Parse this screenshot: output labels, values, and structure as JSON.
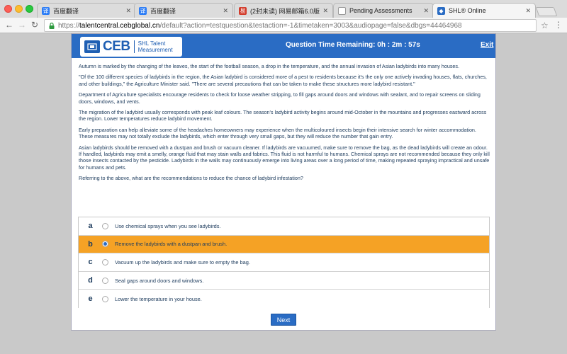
{
  "browser": {
    "tabs": [
      {
        "label": "百度翻译",
        "icon": "baidu-translate-icon",
        "icon_color": "#2b7cf6",
        "active": false
      },
      {
        "label": "百度翻译",
        "icon": "baidu-translate-icon",
        "icon_color": "#2b7cf6",
        "active": false
      },
      {
        "label": "(2封未读) 网易邮箱6.0版",
        "icon": "netease-mail-icon",
        "icon_color": "#d23b2b",
        "active": false
      },
      {
        "label": "Pending Assessments",
        "icon": "document-icon",
        "icon_color": "#ffffff",
        "active": false
      },
      {
        "label": "SHL® Online",
        "icon": "shl-icon",
        "icon_color": "#2a6cc4",
        "active": true
      }
    ],
    "url_host": "talentcentral.cebglobal.cn",
    "url_rest": "/default?action=testquestion&testaction=-1&timetaken=3003&audiopage=false&dbgs=44464968",
    "url_prefix": "https://"
  },
  "header": {
    "logo_ceb": "CEB",
    "logo_shl_line1": "SHL Talent",
    "logo_shl_line2": "Measurement",
    "timer_label": "Question Time Remaining: 0h : 2m : 57s",
    "exit_label": "Exit",
    "brand_color": "#2a6cc4"
  },
  "passage": {
    "paragraphs": [
      "Autumn is marked by the changing of the leaves, the start of the football season, a drop in the temperature, and the annual invasion of Asian ladybirds into many houses.",
      "\"Of the 100 different species of ladybirds in the region, the Asian ladybird is considered more of a pest to residents because it's the only one actively invading houses, flats, churches, and other buildings,\" the Agriculture Minister said. \"There are several precautions that can be taken to make these structures more ladybird resistant.\"",
      "Department of Agriculture specialists encourage residents to check for loose weather stripping, to fill gaps around doors and windows with sealant, and to repair screens on sliding doors, windows, and vents.",
      "The migration of the ladybird usually corresponds with peak leaf colours. The season's ladybird activity begins around mid-October in the mountains and progresses eastward across the region. Lower temperatures reduce ladybird movement.",
      "Early preparation can help alleviate some of the headaches homeowners may experience when the multicoloured insects begin their intensive search for winter accommodation. These measures may not totally exclude the ladybirds, which enter through very small gaps, but they will reduce the number that gain entry.",
      "Asian ladybirds should be removed with a dustpan and brush or vacuum cleaner. If ladybirds are vacuumed, make sure to remove the bag, as the dead ladybirds will create an odour. If handled, ladybirds may emit a smelly, orange fluid that may stain walls and fabrics. This fluid is not harmful to humans. Chemical sprays are not recommended because they only kill those insects contacted by the pesticide. Ladybirds in the walls may continuously emerge into living areas over a long period of time, making repeated spraying impractical and unsafe for humans and pets."
    ],
    "question": "Referring to the above, what are the recommendations to reduce the chance of ladybird infestation?"
  },
  "options": [
    {
      "letter": "a",
      "text": "Use chemical sprays when you see ladybirds.",
      "selected": false
    },
    {
      "letter": "b",
      "text": "Remove the ladybirds with a dustpan and brush.",
      "selected": true
    },
    {
      "letter": "c",
      "text": "Vacuum up the ladybirds and make sure to empty the bag.",
      "selected": false
    },
    {
      "letter": "d",
      "text": "Seal gaps around doors and windows.",
      "selected": false
    },
    {
      "letter": "e",
      "text": "Lower the temperature in your house.",
      "selected": false
    }
  ],
  "next_label": "Next",
  "selected_color": "#f5a225"
}
